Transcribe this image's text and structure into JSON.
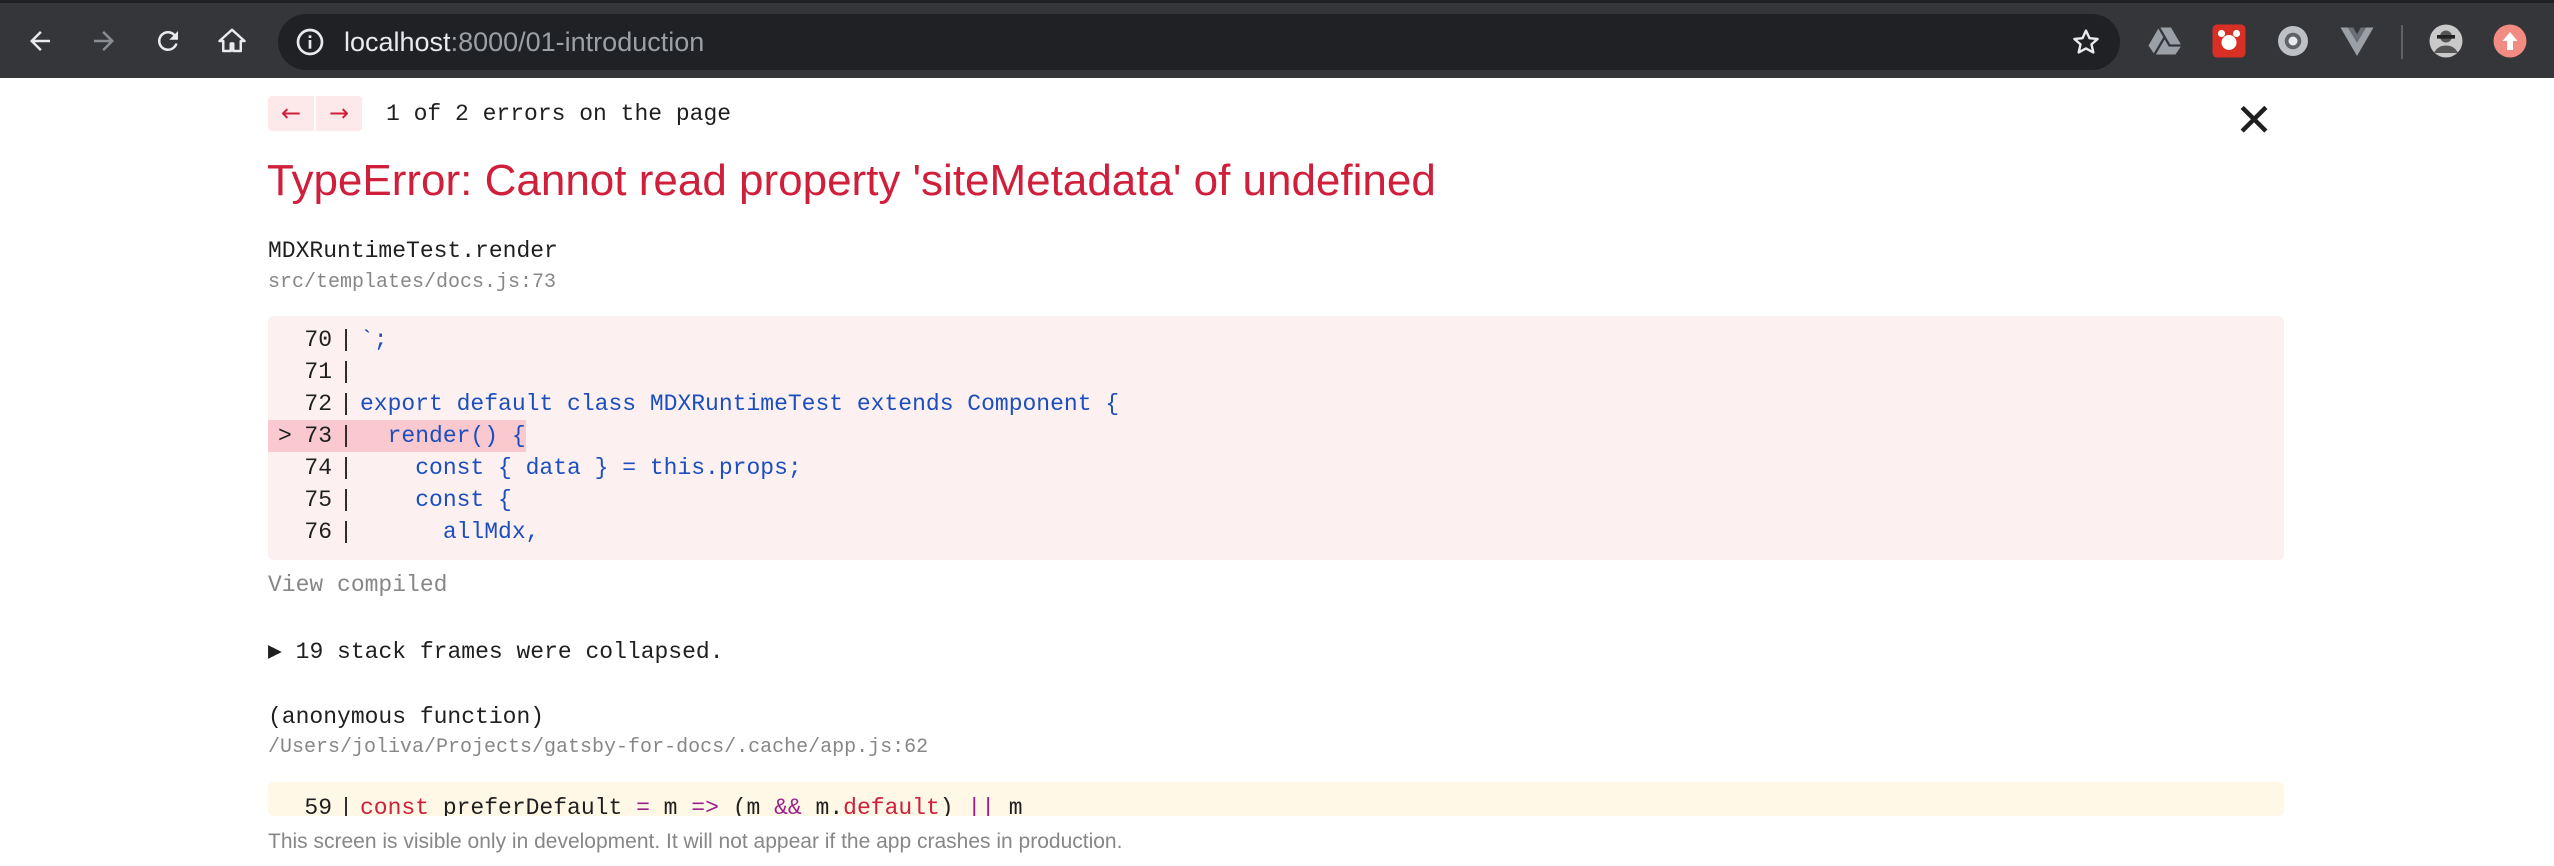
{
  "browser": {
    "url_host": "localhost",
    "url_path": ":8000/01-introduction",
    "icons": {
      "back": "arrow-left-icon",
      "forward": "arrow-right-icon",
      "reload": "reload-icon",
      "home": "home-icon",
      "info": "info-icon",
      "star": "star-icon"
    }
  },
  "overlay": {
    "prev_label": "←",
    "next_label": "→",
    "error_count": "1 of 2 errors on the page",
    "close_label": "✕",
    "title": "TypeError: Cannot read property 'siteMetadata' of undefined",
    "frame1": {
      "function": "MDXRuntimeTest.render",
      "file": "src/templates/docs.js:73",
      "lines": [
        {
          "n": "70",
          "code": "`;",
          "highlight": false
        },
        {
          "n": "71",
          "code": "",
          "highlight": false
        },
        {
          "n": "72",
          "code": "export default class MDXRuntimeTest extends Component {",
          "highlight": false
        },
        {
          "n": "73",
          "code": "  render() {",
          "highlight": true
        },
        {
          "n": "74",
          "code": "    const { data } = this.props;",
          "highlight": false
        },
        {
          "n": "75",
          "code": "    const {",
          "highlight": false
        },
        {
          "n": "76",
          "code": "      allMdx,",
          "highlight": false
        }
      ]
    },
    "view_compiled": "View compiled",
    "collapsed": "▶ 19 stack frames were collapsed.",
    "frame2": {
      "function": "(anonymous function)",
      "file": "/Users/joliva/Projects/gatsby-for-docs/.cache/app.js:62",
      "line_number": "59",
      "code_parts": {
        "kw": "const",
        "name": " preferDefault ",
        "eq": "=",
        "m": " m ",
        "arrow": "=>",
        "open": " (m ",
        "and": "&&",
        "m_dot": " m.",
        "default": "default",
        "close": ") ",
        "or": "||",
        "tail": " m"
      }
    },
    "footer": "This screen is visible only in development. It will not appear if the app crashes in production."
  },
  "colors": {
    "error_red": "#cf1f3b",
    "code_blue": "#1b4fbe",
    "highlight": "#f9c9cf",
    "code_bg": "#fdf0f1",
    "code_bg2": "#fff8e6",
    "muted": "#878787"
  }
}
